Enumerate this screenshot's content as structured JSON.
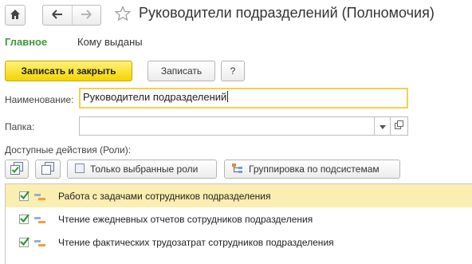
{
  "window": {
    "title": "Руководители подразделений (Полномочия)"
  },
  "tabs": [
    {
      "label": "Главное",
      "active": true
    },
    {
      "label": "Кому выданы",
      "active": false
    }
  ],
  "commands": {
    "save_close_label": "Записать и закрыть",
    "save_label": "Записать",
    "help_label": "?"
  },
  "form": {
    "name_label": "Наименование:",
    "name_value": "Руководители подразделений",
    "folder_label": "Папка:",
    "folder_value": "",
    "roles_label": "Доступные действия (Роли):"
  },
  "roles_toolbar": {
    "only_selected_label": "Только выбранные роли",
    "grouping_label": "Группировка по подсистемам"
  },
  "roles": [
    {
      "label": "Работа с задачами сотрудников подразделения",
      "checked": true,
      "selected": true
    },
    {
      "label": "Чтение ежедневных отчетов сотрудников подразделения",
      "checked": true,
      "selected": false
    },
    {
      "label": "Чтение фактических трудозатрат сотрудников подразделения",
      "checked": true,
      "selected": false
    }
  ],
  "colors": {
    "accent_green": "#3a9a3a",
    "primary_yellow": "#f3d400",
    "focus_yellow": "#f0d24a",
    "selected_row": "#fbeeb1"
  },
  "icons": [
    "home-icon",
    "back-arrow-icon",
    "forward-arrow-icon",
    "star-icon",
    "check-all-icon",
    "uncheck-all-icon",
    "filter-icon",
    "hierarchy-icon",
    "open-icon",
    "role-icon"
  ]
}
